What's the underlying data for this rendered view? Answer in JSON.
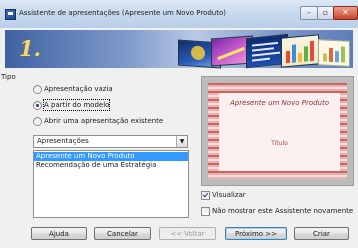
{
  "window": {
    "title": "Assistente de apresentações (Apresente um Novo Produto)",
    "controls": {
      "minimize": "–",
      "maximize": "▫",
      "close": "✕"
    }
  },
  "header": {
    "step": "1."
  },
  "type_group": {
    "label": "Tipo",
    "options": [
      {
        "label": "Apresentação vazia",
        "selected": false
      },
      {
        "label": "A partir do modelo",
        "selected": true
      },
      {
        "label": "Abrir uma apresentação existente",
        "selected": false
      }
    ]
  },
  "template_category": {
    "value": "Apresentações",
    "arrow": "▼"
  },
  "template_list": {
    "items": [
      {
        "label": "Apresente um Novo Produto",
        "selected": true
      },
      {
        "label": "Recomendação de uma Estratégia",
        "selected": false
      }
    ]
  },
  "preview": {
    "slide_title": "Apresente um Novo Produto",
    "slide_subtitle": "Título"
  },
  "options": {
    "preview_checkbox": {
      "label": "Visualizar",
      "checked": true
    },
    "dont_show_checkbox": {
      "label": "Não mostrar este Assistente novamente",
      "checked": false
    }
  },
  "buttons": {
    "help": "Ajuda",
    "cancel": "Cancelar",
    "back": "<< Voltar",
    "next": "Próximo >>",
    "create": "Criar"
  },
  "colors": {
    "selection": "#3399ff",
    "header_blue": "#3f62a4",
    "preview_red": "#c86663"
  }
}
